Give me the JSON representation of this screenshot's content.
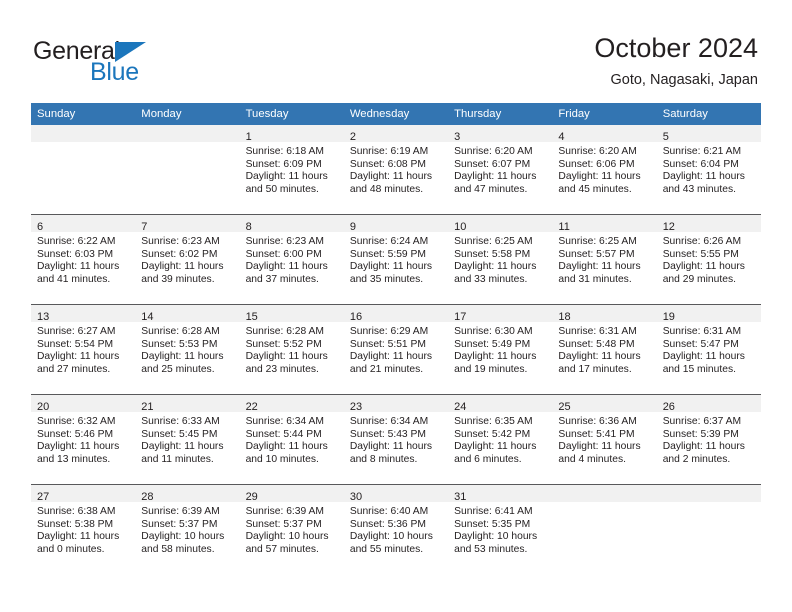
{
  "brand": {
    "name_part1": "General",
    "name_part2": "Blue",
    "colors": {
      "accent": "#1b76bc",
      "text": "#231f20"
    }
  },
  "header": {
    "title": "October 2024",
    "subtitle": "Goto, Nagasaki, Japan"
  },
  "calendar": {
    "header_color": "#3375b2",
    "daynum_band_color": "#f1f1f1",
    "weekday_headers": [
      "Sunday",
      "Monday",
      "Tuesday",
      "Wednesday",
      "Thursday",
      "Friday",
      "Saturday"
    ],
    "weeks": [
      [
        {
          "day": "",
          "sunrise": "",
          "sunset": "",
          "daylight": ""
        },
        {
          "day": "",
          "sunrise": "",
          "sunset": "",
          "daylight": ""
        },
        {
          "day": "1",
          "sunrise": "Sunrise: 6:18 AM",
          "sunset": "Sunset: 6:09 PM",
          "daylight": "Daylight: 11 hours and 50 minutes."
        },
        {
          "day": "2",
          "sunrise": "Sunrise: 6:19 AM",
          "sunset": "Sunset: 6:08 PM",
          "daylight": "Daylight: 11 hours and 48 minutes."
        },
        {
          "day": "3",
          "sunrise": "Sunrise: 6:20 AM",
          "sunset": "Sunset: 6:07 PM",
          "daylight": "Daylight: 11 hours and 47 minutes."
        },
        {
          "day": "4",
          "sunrise": "Sunrise: 6:20 AM",
          "sunset": "Sunset: 6:06 PM",
          "daylight": "Daylight: 11 hours and 45 minutes."
        },
        {
          "day": "5",
          "sunrise": "Sunrise: 6:21 AM",
          "sunset": "Sunset: 6:04 PM",
          "daylight": "Daylight: 11 hours and 43 minutes."
        }
      ],
      [
        {
          "day": "6",
          "sunrise": "Sunrise: 6:22 AM",
          "sunset": "Sunset: 6:03 PM",
          "daylight": "Daylight: 11 hours and 41 minutes."
        },
        {
          "day": "7",
          "sunrise": "Sunrise: 6:23 AM",
          "sunset": "Sunset: 6:02 PM",
          "daylight": "Daylight: 11 hours and 39 minutes."
        },
        {
          "day": "8",
          "sunrise": "Sunrise: 6:23 AM",
          "sunset": "Sunset: 6:00 PM",
          "daylight": "Daylight: 11 hours and 37 minutes."
        },
        {
          "day": "9",
          "sunrise": "Sunrise: 6:24 AM",
          "sunset": "Sunset: 5:59 PM",
          "daylight": "Daylight: 11 hours and 35 minutes."
        },
        {
          "day": "10",
          "sunrise": "Sunrise: 6:25 AM",
          "sunset": "Sunset: 5:58 PM",
          "daylight": "Daylight: 11 hours and 33 minutes."
        },
        {
          "day": "11",
          "sunrise": "Sunrise: 6:25 AM",
          "sunset": "Sunset: 5:57 PM",
          "daylight": "Daylight: 11 hours and 31 minutes."
        },
        {
          "day": "12",
          "sunrise": "Sunrise: 6:26 AM",
          "sunset": "Sunset: 5:55 PM",
          "daylight": "Daylight: 11 hours and 29 minutes."
        }
      ],
      [
        {
          "day": "13",
          "sunrise": "Sunrise: 6:27 AM",
          "sunset": "Sunset: 5:54 PM",
          "daylight": "Daylight: 11 hours and 27 minutes."
        },
        {
          "day": "14",
          "sunrise": "Sunrise: 6:28 AM",
          "sunset": "Sunset: 5:53 PM",
          "daylight": "Daylight: 11 hours and 25 minutes."
        },
        {
          "day": "15",
          "sunrise": "Sunrise: 6:28 AM",
          "sunset": "Sunset: 5:52 PM",
          "daylight": "Daylight: 11 hours and 23 minutes."
        },
        {
          "day": "16",
          "sunrise": "Sunrise: 6:29 AM",
          "sunset": "Sunset: 5:51 PM",
          "daylight": "Daylight: 11 hours and 21 minutes."
        },
        {
          "day": "17",
          "sunrise": "Sunrise: 6:30 AM",
          "sunset": "Sunset: 5:49 PM",
          "daylight": "Daylight: 11 hours and 19 minutes."
        },
        {
          "day": "18",
          "sunrise": "Sunrise: 6:31 AM",
          "sunset": "Sunset: 5:48 PM",
          "daylight": "Daylight: 11 hours and 17 minutes."
        },
        {
          "day": "19",
          "sunrise": "Sunrise: 6:31 AM",
          "sunset": "Sunset: 5:47 PM",
          "daylight": "Daylight: 11 hours and 15 minutes."
        }
      ],
      [
        {
          "day": "20",
          "sunrise": "Sunrise: 6:32 AM",
          "sunset": "Sunset: 5:46 PM",
          "daylight": "Daylight: 11 hours and 13 minutes."
        },
        {
          "day": "21",
          "sunrise": "Sunrise: 6:33 AM",
          "sunset": "Sunset: 5:45 PM",
          "daylight": "Daylight: 11 hours and 11 minutes."
        },
        {
          "day": "22",
          "sunrise": "Sunrise: 6:34 AM",
          "sunset": "Sunset: 5:44 PM",
          "daylight": "Daylight: 11 hours and 10 minutes."
        },
        {
          "day": "23",
          "sunrise": "Sunrise: 6:34 AM",
          "sunset": "Sunset: 5:43 PM",
          "daylight": "Daylight: 11 hours and 8 minutes."
        },
        {
          "day": "24",
          "sunrise": "Sunrise: 6:35 AM",
          "sunset": "Sunset: 5:42 PM",
          "daylight": "Daylight: 11 hours and 6 minutes."
        },
        {
          "day": "25",
          "sunrise": "Sunrise: 6:36 AM",
          "sunset": "Sunset: 5:41 PM",
          "daylight": "Daylight: 11 hours and 4 minutes."
        },
        {
          "day": "26",
          "sunrise": "Sunrise: 6:37 AM",
          "sunset": "Sunset: 5:39 PM",
          "daylight": "Daylight: 11 hours and 2 minutes."
        }
      ],
      [
        {
          "day": "27",
          "sunrise": "Sunrise: 6:38 AM",
          "sunset": "Sunset: 5:38 PM",
          "daylight": "Daylight: 11 hours and 0 minutes."
        },
        {
          "day": "28",
          "sunrise": "Sunrise: 6:39 AM",
          "sunset": "Sunset: 5:37 PM",
          "daylight": "Daylight: 10 hours and 58 minutes."
        },
        {
          "day": "29",
          "sunrise": "Sunrise: 6:39 AM",
          "sunset": "Sunset: 5:37 PM",
          "daylight": "Daylight: 10 hours and 57 minutes."
        },
        {
          "day": "30",
          "sunrise": "Sunrise: 6:40 AM",
          "sunset": "Sunset: 5:36 PM",
          "daylight": "Daylight: 10 hours and 55 minutes."
        },
        {
          "day": "31",
          "sunrise": "Sunrise: 6:41 AM",
          "sunset": "Sunset: 5:35 PM",
          "daylight": "Daylight: 10 hours and 53 minutes."
        },
        {
          "day": "",
          "sunrise": "",
          "sunset": "",
          "daylight": ""
        },
        {
          "day": "",
          "sunrise": "",
          "sunset": "",
          "daylight": ""
        }
      ]
    ]
  }
}
